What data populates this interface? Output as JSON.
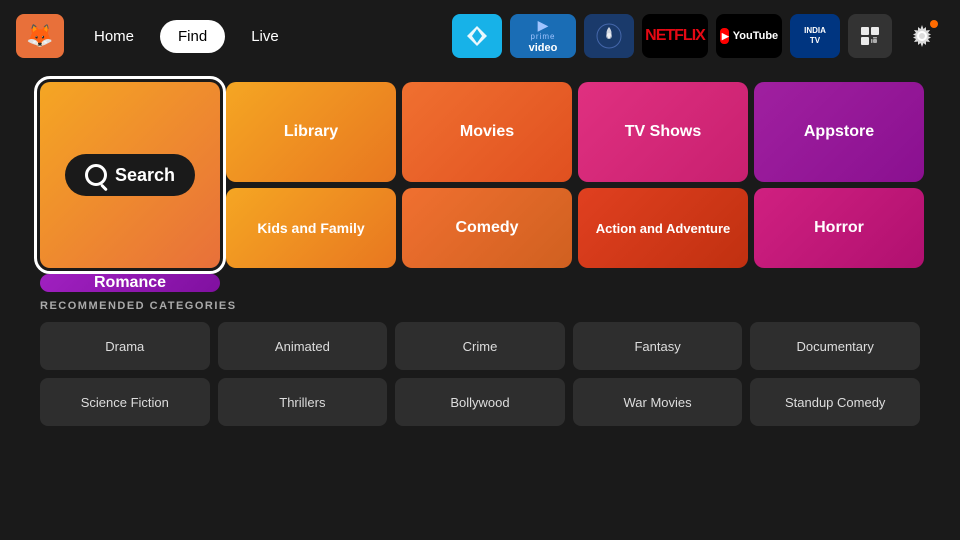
{
  "nav": {
    "logo_emoji": "🦊",
    "links": [
      {
        "label": "Home",
        "active": false
      },
      {
        "label": "Find",
        "active": true
      },
      {
        "label": "Live",
        "active": false
      }
    ],
    "apps": [
      {
        "name": "kodi",
        "label": "Kodi"
      },
      {
        "name": "prime",
        "label": "prime video"
      },
      {
        "name": "paramount",
        "label": "⊕"
      },
      {
        "name": "netflix",
        "label": "NETFLIX"
      },
      {
        "name": "youtube",
        "label": "YouTube"
      },
      {
        "name": "india-tv",
        "label": "INDIA TV"
      },
      {
        "name": "grid",
        "label": "⊞"
      },
      {
        "name": "settings",
        "label": "⚙"
      }
    ]
  },
  "tiles": {
    "search_label": "Search",
    "library_label": "Library",
    "movies_label": "Movies",
    "tvshows_label": "TV Shows",
    "appstore_label": "Appstore",
    "kids_label": "Kids and Family",
    "comedy_label": "Comedy",
    "action_label": "Action and Adventure",
    "horror_label": "Horror",
    "romance_label": "Romance"
  },
  "recommended": {
    "section_title": "RECOMMENDED CATEGORIES",
    "row1": [
      {
        "label": "Drama"
      },
      {
        "label": "Animated"
      },
      {
        "label": "Crime"
      },
      {
        "label": "Fantasy"
      },
      {
        "label": "Documentary"
      }
    ],
    "row2": [
      {
        "label": "Science Fiction"
      },
      {
        "label": "Thrillers"
      },
      {
        "label": "Bollywood"
      },
      {
        "label": "War Movies"
      },
      {
        "label": "Standup Comedy"
      }
    ]
  }
}
